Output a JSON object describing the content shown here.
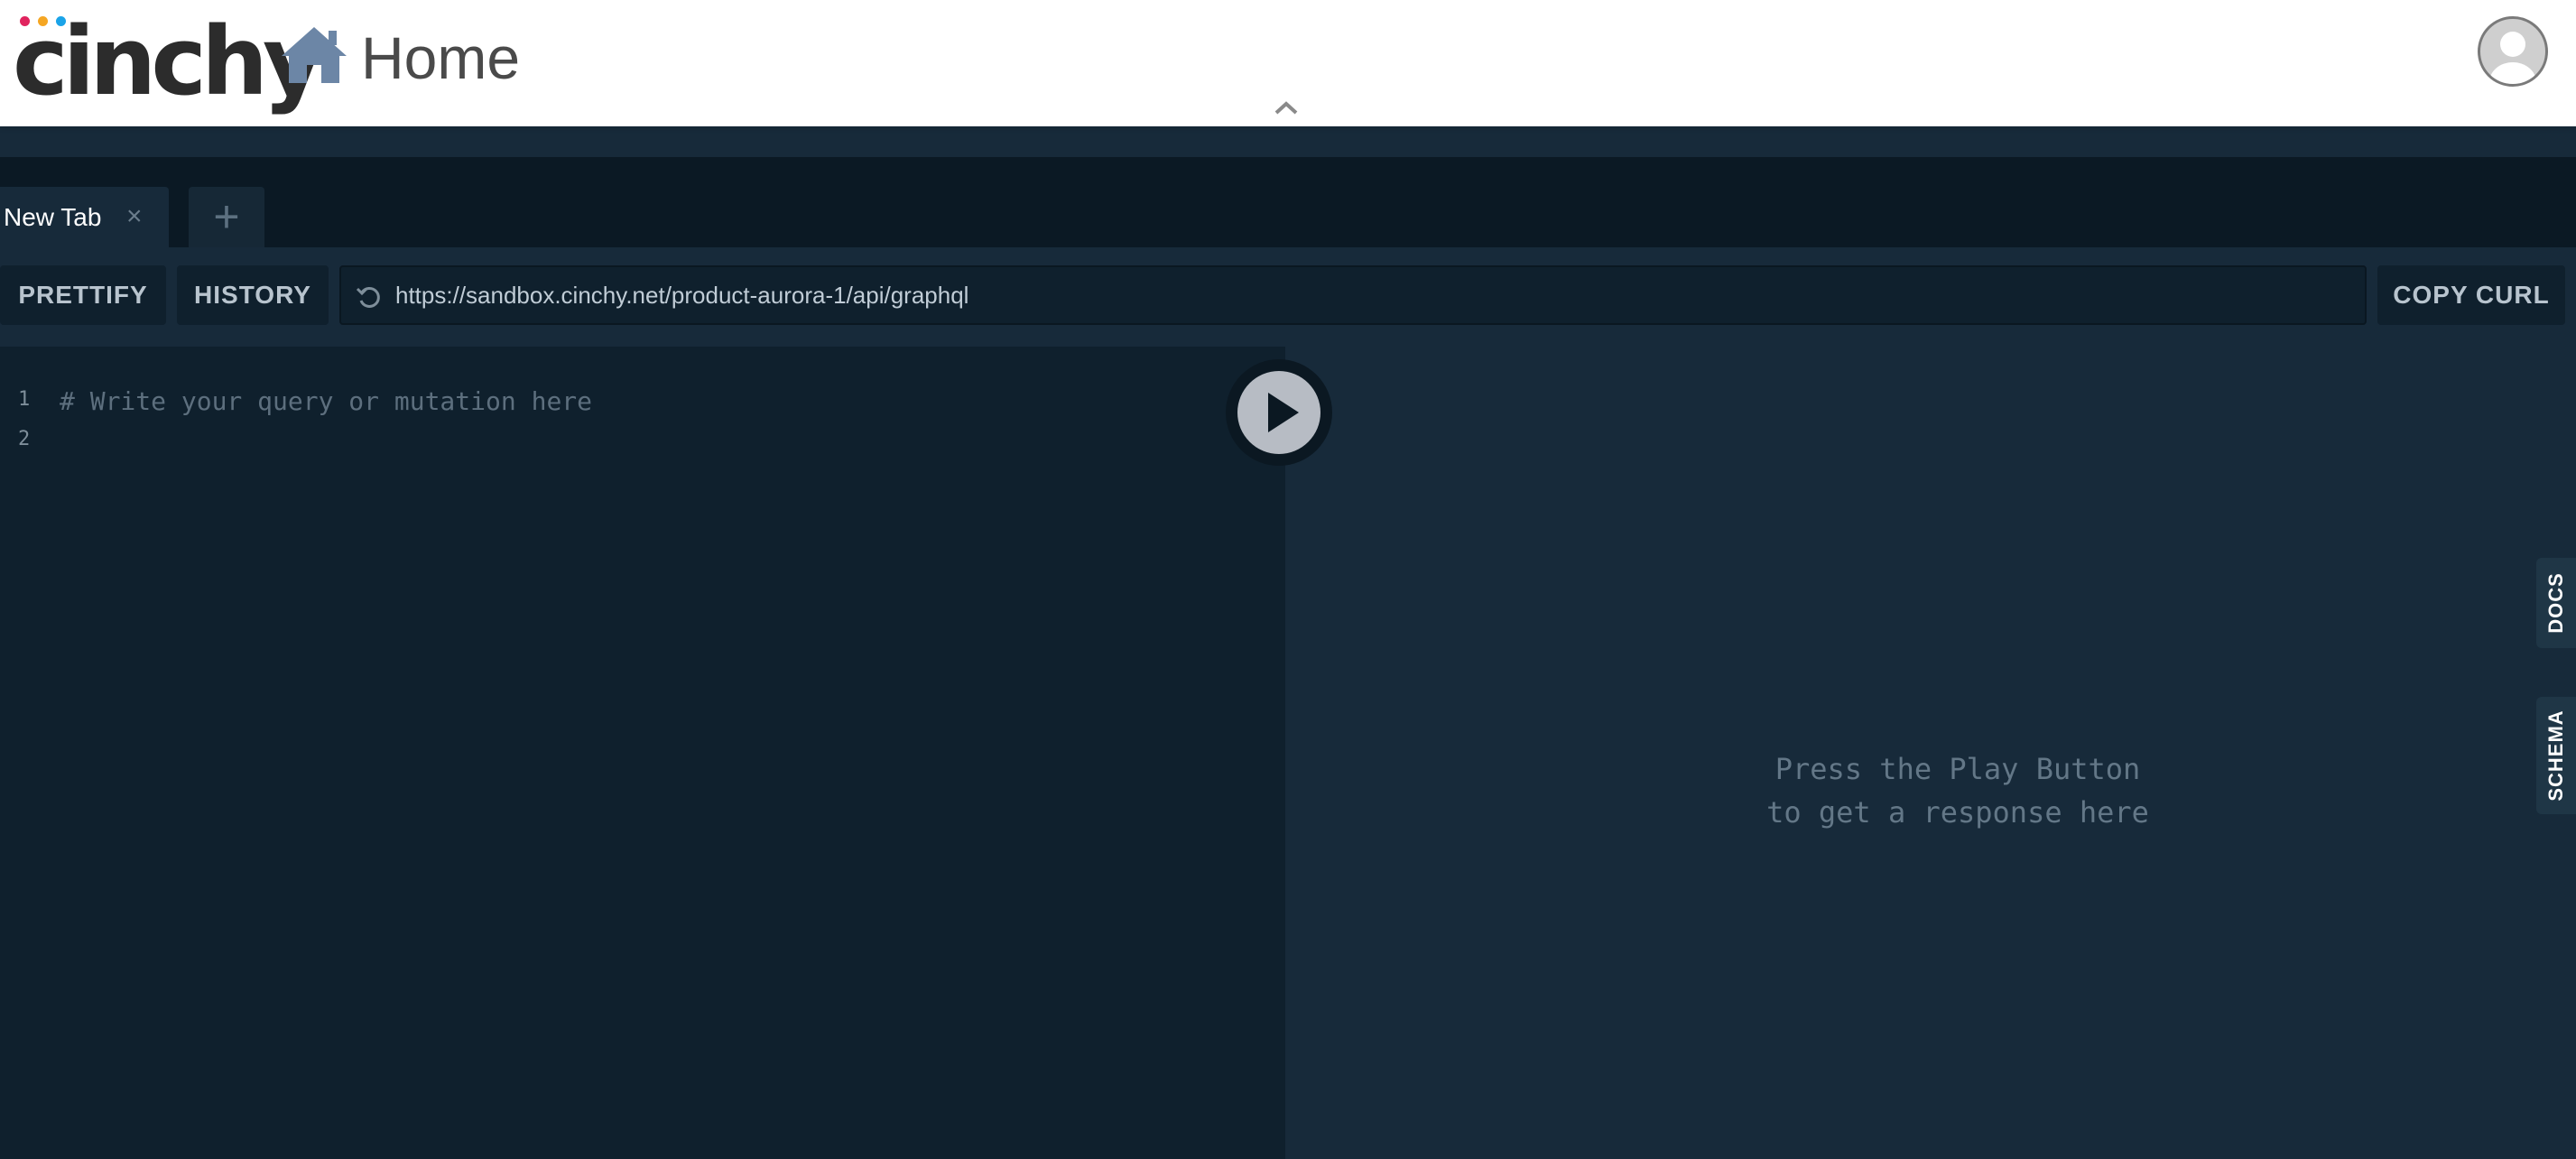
{
  "header": {
    "logo_text": "cinchy",
    "page_title": "Home",
    "brand_colors": {
      "dot1": "#e0245e",
      "dot2": "#f5a623",
      "dot3": "#1aa3e8",
      "home_icon": "#6c86a6"
    }
  },
  "tabs": {
    "items": [
      {
        "label": "New Tab",
        "close_icon": "×"
      }
    ],
    "add_label": "+"
  },
  "toolbar": {
    "prettify_label": "PRETTIFY",
    "history_label": "HISTORY",
    "endpoint_url": "https://sandbox.cinchy.net/product-aurora-1/api/graphql",
    "copy_curl_label": "COPY CURL"
  },
  "editor": {
    "line_numbers": [
      "1",
      "2"
    ],
    "lines": [
      "# Write your query or mutation here",
      ""
    ]
  },
  "result": {
    "hint_line1": "Press the Play Button",
    "hint_line2": "to get a response here"
  },
  "side_tabs": {
    "docs_label": "DOCS",
    "schema_label": "SCHEMA"
  }
}
